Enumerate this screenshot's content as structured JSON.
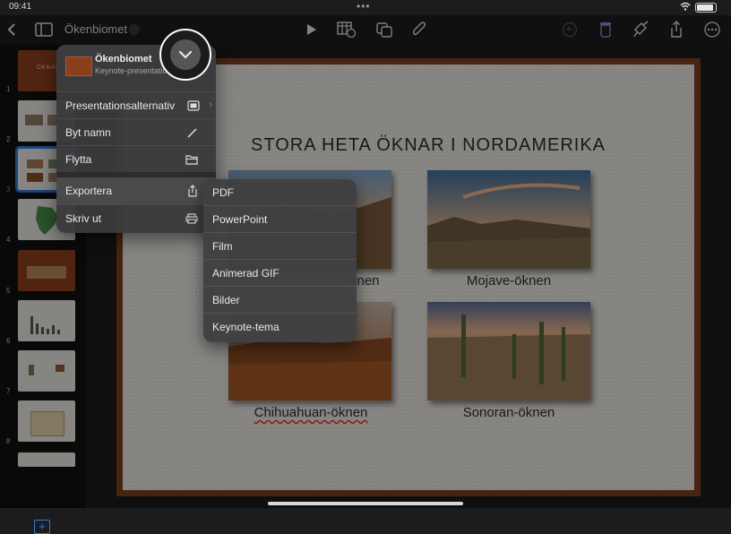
{
  "status": {
    "time": "09:41",
    "battery_level": 1.0
  },
  "toolbar": {
    "doc_title": "Ökenbiomet",
    "icons": [
      "back-icon",
      "sidebar-icon",
      "chevron-down-icon",
      "play-icon",
      "table-icon",
      "shapes-icon",
      "attachment-icon",
      "undo-icon",
      "trash-icon",
      "format-brush-icon",
      "share-icon",
      "more-icon"
    ]
  },
  "navigator": {
    "slides": [
      {
        "num": "1",
        "title": "ÖKNAR"
      },
      {
        "num": "2",
        "title": ""
      },
      {
        "num": "3",
        "title": ""
      },
      {
        "num": "4",
        "title": ""
      },
      {
        "num": "5",
        "title": ""
      },
      {
        "num": "6",
        "title": ""
      },
      {
        "num": "7",
        "title": ""
      },
      {
        "num": "8",
        "title": ""
      }
    ],
    "selected": "3",
    "add_icon": "plus-icon"
  },
  "slide": {
    "title": "STORA HETA ÖKNAR I NORDAMERIKA",
    "captions": [
      "Mojave-öknen",
      "Chihuahuan-öknen",
      "Sonoran-öknen"
    ],
    "partial_caption": "knen"
  },
  "menu": {
    "doc_name": "Ökenbiomet",
    "doc_kind": "Keynote-presentation",
    "items": [
      {
        "label": "Presentationsalternativ",
        "icon": "presentation-icon"
      },
      {
        "label": "Byt namn",
        "icon": "pencil-icon"
      },
      {
        "label": "Flytta",
        "icon": "folder-icon"
      },
      {
        "label": "Exportera",
        "icon": "share-icon"
      },
      {
        "label": "Skriv ut",
        "icon": "printer-icon"
      }
    ]
  },
  "export_menu": {
    "items": [
      "PDF",
      "PowerPoint",
      "Film",
      "Animerad GIF",
      "Bilder",
      "Keynote-tema"
    ]
  },
  "colors": {
    "accent": "#2f78d6",
    "slide_border": "#7a3d1f",
    "underline": "#dd3333"
  }
}
